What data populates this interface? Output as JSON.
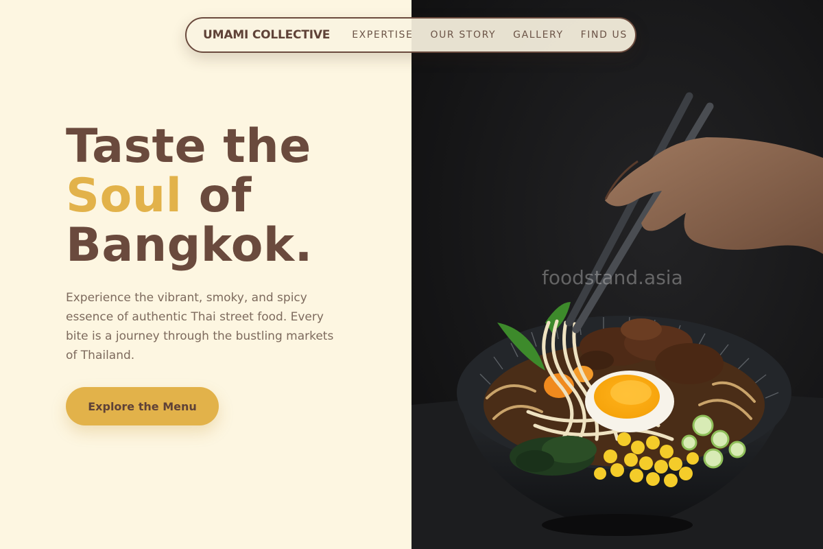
{
  "nav": {
    "brand": "UMAMI COLLECTIVE",
    "links": [
      "EXPERTISE",
      "OUR STORY",
      "GALLERY",
      "FIND US"
    ]
  },
  "hero": {
    "title_line1": "Taste the",
    "title_accent": "Soul",
    "title_line2_rest": " of",
    "title_line3": "Bangkok.",
    "description": "Experience the vibrant, smoky, and spicy essence of authentic Thai street food. Every bite is a journey through the bustling markets of Thailand.",
    "cta_label": "Explore the Menu"
  },
  "image": {
    "watermark": "foodstand.asia"
  },
  "colors": {
    "cream_background": "#fdf6e1",
    "brown_text": "#6a4a3d",
    "gold_accent": "#e2b24a",
    "dark_photo_background": "#141415"
  },
  "icons": [
    "noodle-bowl-photo",
    "chopsticks",
    "hand"
  ]
}
